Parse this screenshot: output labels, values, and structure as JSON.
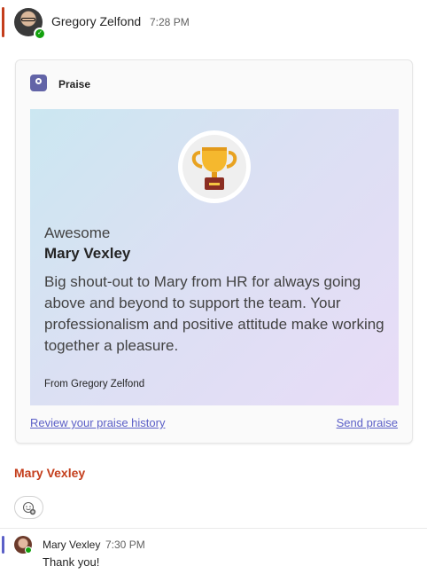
{
  "message": {
    "sender": "Gregory Zelfond",
    "time": "7:28 PM",
    "presence": "available"
  },
  "card": {
    "app_label": "Praise",
    "badge_icon": "trophy-icon",
    "praise_type": "Awesome",
    "recipient": "Mary Vexley",
    "body": "Big shout-out to Mary from HR for always going above and beyond to support the team. Your professionalism and positive attitude make working together a pleasure.",
    "from": "From Gregory Zelfond",
    "links": {
      "history": "Review your praise history",
      "send": "Send praise"
    }
  },
  "mention": "Mary Vexley",
  "reaction_button": {
    "icon": "add-reaction-icon"
  },
  "reply": {
    "sender": "Mary Vexley",
    "time": "7:30 PM",
    "text": "Thank you!",
    "presence": "available"
  },
  "colors": {
    "accent_orange": "#c43e1c",
    "accent_purple": "#5b5fc7",
    "presence_green": "#13a10e"
  }
}
